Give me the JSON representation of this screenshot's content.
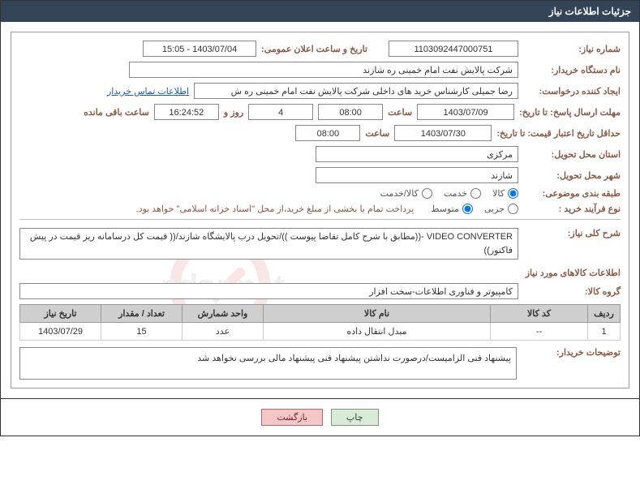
{
  "header": {
    "title": "جزئیات اطلاعات نیاز"
  },
  "fields": {
    "need_no_label": "شماره نیاز:",
    "need_no": "1103092447000751",
    "announce_label": "تاریخ و ساعت اعلان عمومی:",
    "announce_value": "1403/07/04 - 15:05",
    "buyer_org_label": "نام دستگاه خریدار:",
    "buyer_org": "شرکت پالایش نفت امام خمینی  ره  شازند",
    "requester_label": "ایجاد کننده درخواست:",
    "requester": "رضا جمیلی کارشناس خرید های داخلی  شرکت پالایش نفت امام خمینی  ره  ش",
    "contact_link": "اطلاعات تماس خریدار",
    "reply_deadline_label": "مهلت ارسال پاسخ: تا تاریخ:",
    "reply_date": "1403/07/09",
    "time_label": "ساعت",
    "reply_time": "08:00",
    "days_value": "4",
    "days_and": "روز و",
    "countdown": "16:24:52",
    "remaining": "ساعت باقی مانده",
    "price_valid_label": "حداقل تاریخ اعتبار قیمت: تا تاریخ:",
    "price_valid_date": "1403/07/30",
    "price_valid_time": "08:00",
    "province_label": "استان محل تحویل:",
    "province": "مرکزی",
    "city_label": "شهر محل تحویل:",
    "city": "شازند",
    "category_label": "طبقه بندی موضوعی:",
    "cat_goods": "کالا",
    "cat_service": "خدمت",
    "cat_both": "کالا/خدمت",
    "process_label": "نوع فرآیند خرید :",
    "proc_small": "جزیی",
    "proc_medium": "متوسط",
    "payment_note": "پرداخت تمام یا بخشی از مبلغ خرید،از محل \"اسناد خزانه اسلامی\" خواهد بود.",
    "summary_label": "شرح کلی نیاز:",
    "summary": "VIDEO CONVERTER -((مطابق با شرح کامل تقاضا پیوست ))/تحویل درب پالایشگاه شازند/(( قیمت کل درسامانه ریز قیمت در پیش فاکتور))",
    "items_title": "اطلاعات کالاهای مورد نیاز",
    "group_label": "گروه کالا:",
    "group": "کامپیوتر و فناوری اطلاعات-سخت افزار",
    "desc_label": "توضیحات خریدار:",
    "desc": "پیشنهاد فنی الزامیست/درصورت نداشتن پیشنهاد فنی پیشنهاد مالی بررسی نخواهد شد"
  },
  "table": {
    "headers": {
      "row": "ردیف",
      "code": "کد کالا",
      "name": "نام کالا",
      "unit": "واحد شمارش",
      "qty": "تعداد / مقدار",
      "date": "تاریخ نیاز"
    },
    "rows": [
      {
        "row": "1",
        "code": "--",
        "name": "مبدل انتقال داده",
        "unit": "عدد",
        "qty": "15",
        "date": "1403/07/29"
      }
    ]
  },
  "buttons": {
    "print": "چاپ",
    "back": "بازگشت"
  }
}
